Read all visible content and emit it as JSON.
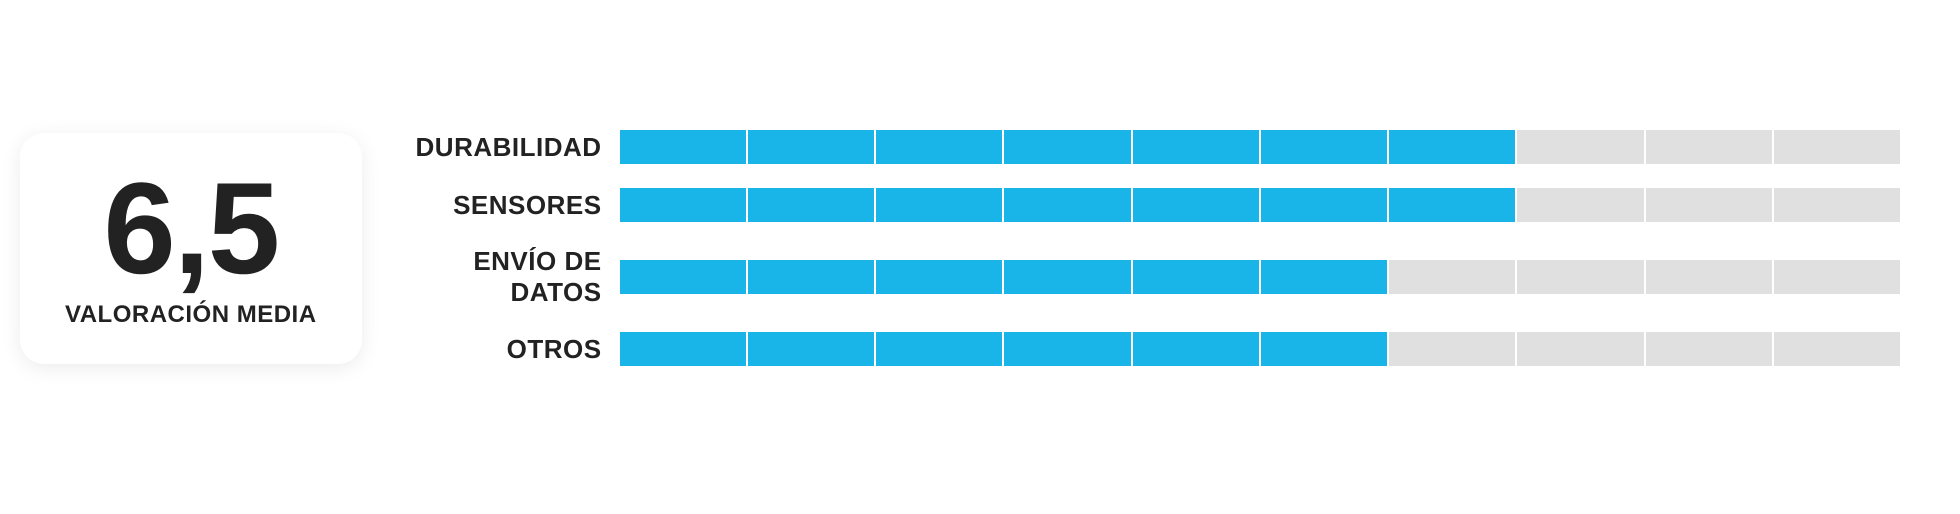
{
  "score": {
    "value": "6,5",
    "label": "VALORACIÓN MEDIA"
  },
  "colors": {
    "accent": "#1ab5e8",
    "track": "#e0e0e0",
    "text": "#222222"
  },
  "chart_data": {
    "type": "bar",
    "categories": [
      "DURABILIDAD",
      "SENSORES",
      "ENVÍO DE DATOS",
      "OTROS"
    ],
    "values": [
      7.0,
      7.0,
      6.0,
      6.0
    ],
    "xlim": [
      0,
      10
    ],
    "ylabel": "",
    "xlabel": "",
    "title": "",
    "segments": 10
  }
}
